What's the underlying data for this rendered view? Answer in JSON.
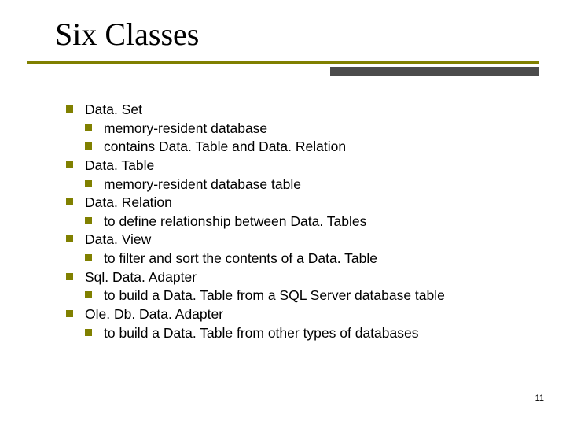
{
  "title": "Six Classes",
  "items": [
    {
      "label": "Data. Set",
      "sub": [
        "memory-resident database",
        "contains Data. Table and Data. Relation"
      ]
    },
    {
      "label": "Data. Table",
      "sub": [
        "memory-resident database table"
      ]
    },
    {
      "label": "Data. Relation",
      "sub": [
        "to define relationship between Data. Tables"
      ]
    },
    {
      "label": "Data. View",
      "sub": [
        "to filter and sort the contents of a Data. Table"
      ]
    },
    {
      "label": "Sql. Data. Adapter",
      "sub": [
        "to build a Data. Table from a SQL Server database table"
      ]
    },
    {
      "label": "Ole. Db. Data. Adapter",
      "sub": [
        "to build a Data. Table from other types of databases"
      ]
    }
  ],
  "page_number": "11"
}
